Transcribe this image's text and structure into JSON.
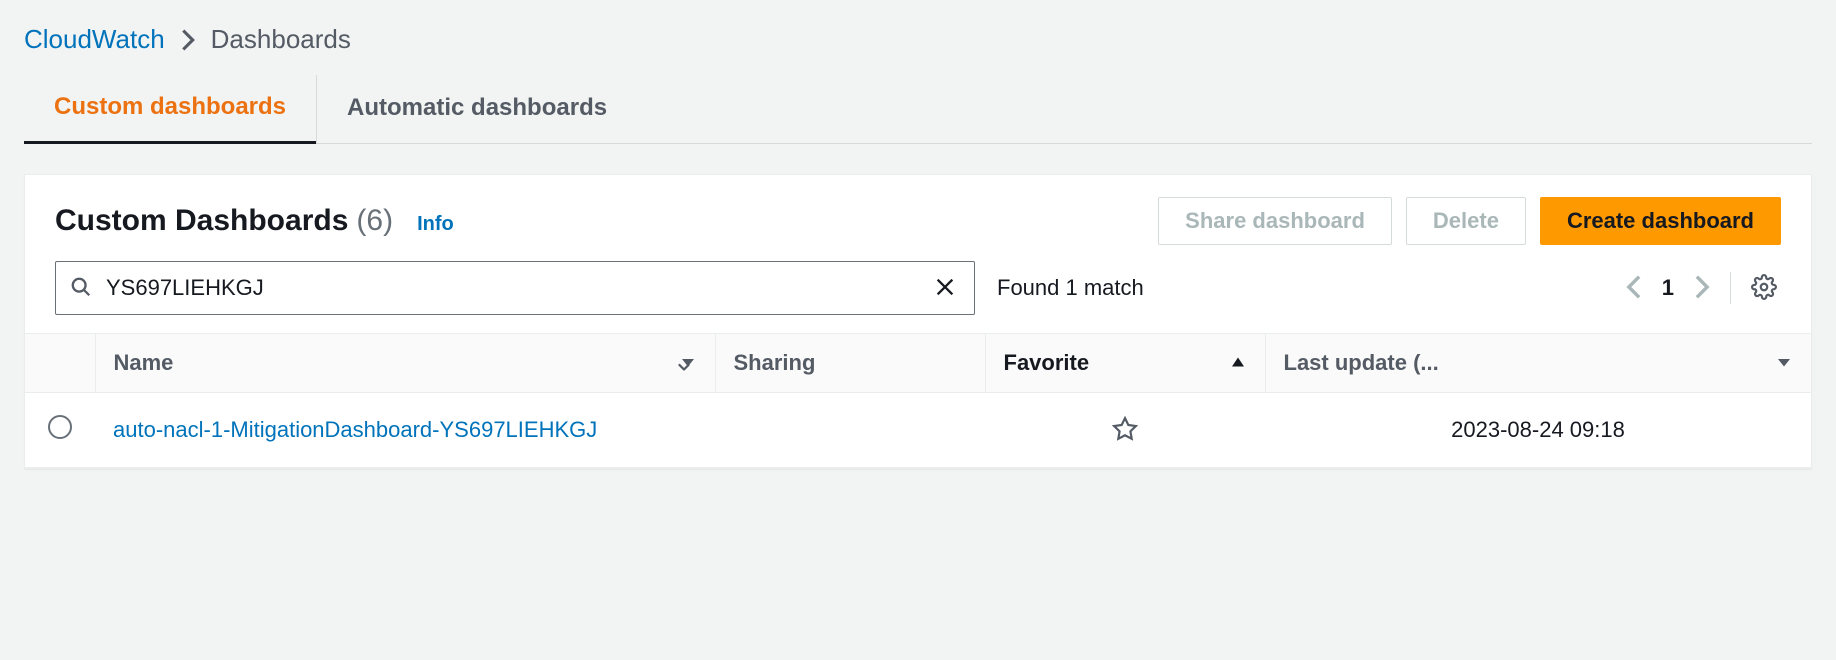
{
  "breadcrumb": {
    "root": "CloudWatch",
    "current": "Dashboards"
  },
  "tabs": {
    "custom": "Custom dashboards",
    "automatic": "Automatic dashboards"
  },
  "panel": {
    "title": "Custom Dashboards",
    "count": "(6)",
    "info": "Info"
  },
  "actions": {
    "share": "Share dashboard",
    "delete": "Delete",
    "create": "Create dashboard"
  },
  "search": {
    "value": "YS697LIEHKGJ",
    "match_text": "Found 1 match"
  },
  "pagination": {
    "page": "1"
  },
  "columns": {
    "name": "Name",
    "sharing": "Sharing",
    "favorite": "Favorite",
    "last_update": "Last update (..."
  },
  "rows": [
    {
      "name": "auto-nacl-1-MitigationDashboard-YS697LIEHKGJ",
      "sharing": "",
      "favorite": false,
      "last_update": "2023-08-24 09:18"
    }
  ]
}
